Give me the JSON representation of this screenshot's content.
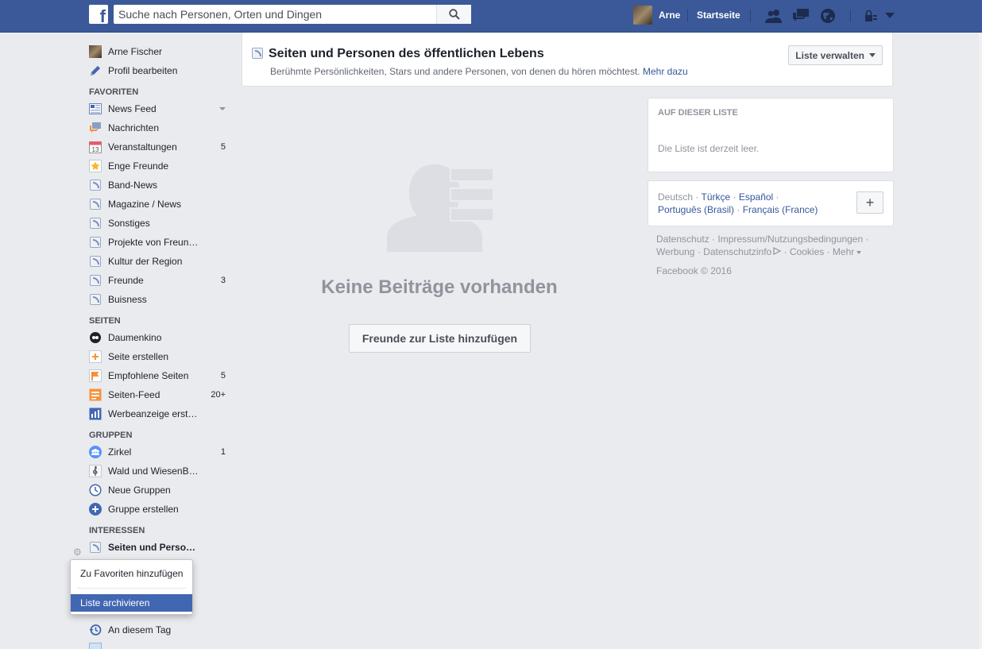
{
  "topbar": {
    "search_placeholder": "Suche nach Personen, Orten und Dingen",
    "user_name": "Arne",
    "home_label": "Startseite"
  },
  "profile": {
    "name": "Arne Fischer",
    "edit": "Profil bearbeiten"
  },
  "sections": {
    "favorites": "FAVORITEN",
    "pages": "SEITEN",
    "groups": "GRUPPEN",
    "interests": "INTERESSEN"
  },
  "favorites": [
    {
      "label": "News Feed",
      "count": ""
    },
    {
      "label": "Nachrichten",
      "count": ""
    },
    {
      "label": "Veranstaltungen",
      "count": "5"
    },
    {
      "label": "Enge Freunde",
      "count": ""
    },
    {
      "label": "Band-News",
      "count": ""
    },
    {
      "label": "Magazine / News",
      "count": ""
    },
    {
      "label": "Sonstiges",
      "count": ""
    },
    {
      "label": "Projekte von Freun…",
      "count": ""
    },
    {
      "label": "Kultur der Region",
      "count": ""
    },
    {
      "label": "Freunde",
      "count": "3"
    },
    {
      "label": "Buisness",
      "count": ""
    }
  ],
  "pages": [
    {
      "label": "Daumenkino",
      "count": ""
    },
    {
      "label": "Seite erstellen",
      "count": ""
    },
    {
      "label": "Empfohlene Seiten",
      "count": "5"
    },
    {
      "label": "Seiten-Feed",
      "count": "20+"
    },
    {
      "label": "Werbeanzeige erst…",
      "count": ""
    }
  ],
  "groups": [
    {
      "label": "Zirkel",
      "count": "1"
    },
    {
      "label": "Wald und WiesenB…",
      "count": ""
    },
    {
      "label": "Neue Gruppen",
      "count": ""
    },
    {
      "label": "Gruppe erstellen",
      "count": ""
    }
  ],
  "interests": [
    {
      "label": "Seiten und Perso…"
    }
  ],
  "more_nav": {
    "on_this_day": "An diesem Tag"
  },
  "context_menu": {
    "add_favorites": "Zu Favoriten hinzufügen",
    "archive": "Liste archivieren"
  },
  "header": {
    "title": "Seiten und Personen des öffentlichen Lebens",
    "description": "Berühmte Persönlichkeiten, Stars und andere Personen, von denen du hören möchtest.",
    "more_link": "Mehr dazu",
    "manage_button": "Liste verwalten"
  },
  "empty": {
    "title": "Keine Beiträge vorhanden",
    "add_button": "Freunde zur Liste hinzufügen"
  },
  "on_list": {
    "heading": "AUF DIESER LISTE",
    "body": "Die Liste ist derzeit leer."
  },
  "languages": {
    "current": "Deutsch",
    "links": [
      "Türkçe",
      "Español",
      "Português (Brasil)",
      "Français (France)"
    ],
    "plus": "+"
  },
  "footer": {
    "links": [
      "Datenschutz",
      "Impressum/Nutzungsbedingungen",
      "Werbung",
      "Datenschutzinfo",
      "Cookies",
      "Mehr"
    ],
    "copyright": "Facebook © 2016"
  },
  "colors": {
    "brand": "#3b5998",
    "link": "#365899",
    "menu_active": "#4267b2"
  }
}
